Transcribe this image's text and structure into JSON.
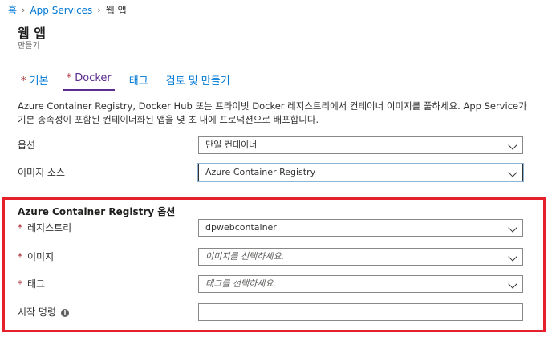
{
  "breadcrumb": {
    "home": "홈",
    "app_services": "App Services",
    "current": "웹 앱"
  },
  "header": {
    "title": "웹 앱",
    "subtitle": "만들기"
  },
  "tabs": [
    {
      "label": "기본",
      "required": "*"
    },
    {
      "label": "Docker",
      "required": "*"
    },
    {
      "label": "태그"
    },
    {
      "label": "검토 및 만들기"
    }
  ],
  "description": "Azure Container Registry, Docker Hub 또는 프라이빗 Docker 레지스트리에서 컨테이너 이미지를 풀하세요. App Service가 기본 종속성이 포함된 컨테이너화된 앱을 몇 초 내에 프로덕션으로 배포합니다.",
  "form": {
    "options": {
      "label": "옵션",
      "value": "단일 컨테이너"
    },
    "image_source": {
      "label": "이미지 소스",
      "value": "Azure Container Registry"
    }
  },
  "acr": {
    "title": "Azure Container Registry 옵션",
    "required_mark": "*",
    "registry": {
      "label": "레지스트리",
      "value": "dpwebcontainer"
    },
    "image": {
      "label": "이미지",
      "placeholder": "이미지를 선택하세요."
    },
    "tag": {
      "label": "태그",
      "placeholder": "태그를 선택하세요."
    },
    "startup": {
      "label": "시작 명령",
      "value": ""
    }
  },
  "colors": {
    "accent": "#0078d4",
    "active_tab": "#5c2d91",
    "highlight_box": "#e3202b",
    "required": "#a4262c"
  }
}
